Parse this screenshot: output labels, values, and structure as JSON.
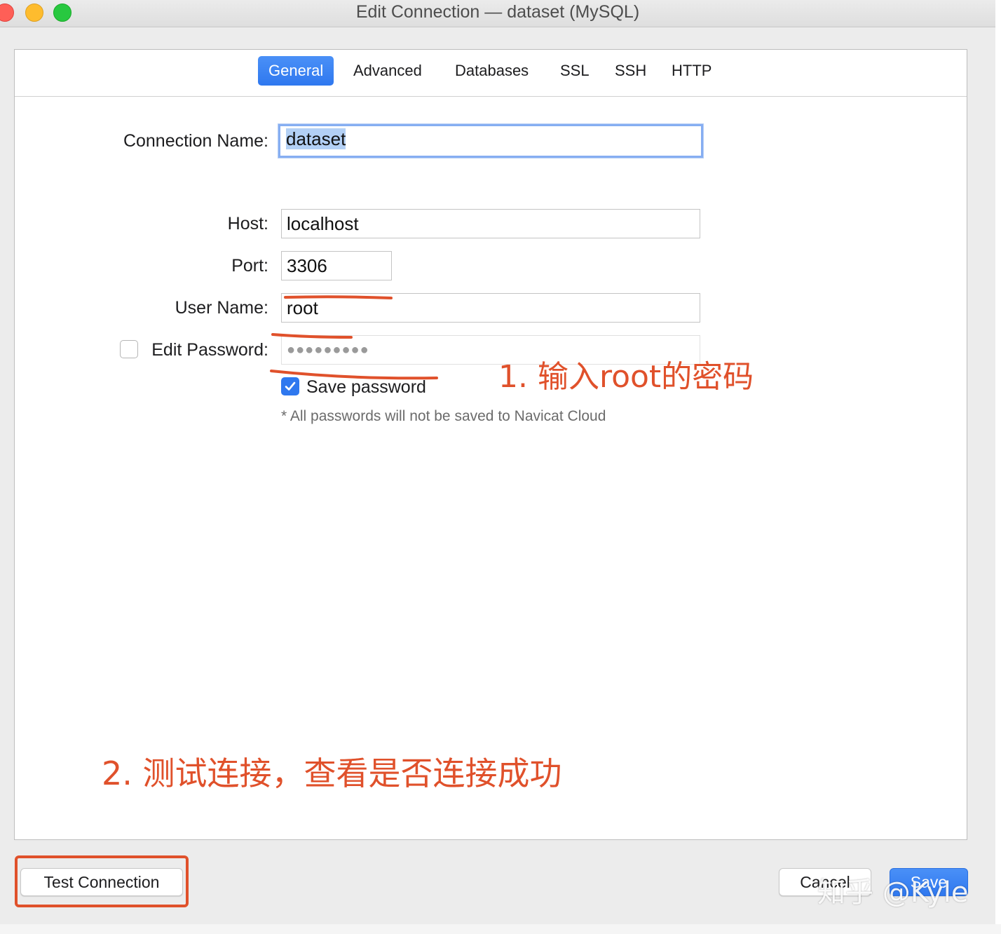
{
  "window": {
    "title": "Edit Connection — dataset (MySQL)"
  },
  "tabs": [
    {
      "label": "General",
      "active": true
    },
    {
      "label": "Advanced",
      "active": false
    },
    {
      "label": "Databases",
      "active": false
    },
    {
      "label": "SSL",
      "active": false
    },
    {
      "label": "SSH",
      "active": false
    },
    {
      "label": "HTTP",
      "active": false
    }
  ],
  "form": {
    "connection_name_label": "Connection Name:",
    "connection_name_value": "dataset",
    "host_label": "Host:",
    "host_value": "localhost",
    "port_label": "Port:",
    "port_value": "3306",
    "username_label": "User Name:",
    "username_value": "root",
    "edit_password_label": "Edit Password:",
    "edit_password_checked": false,
    "password_value": "●●●●●●●●●",
    "save_password_label": "Save password",
    "save_password_checked": true,
    "cloud_note": "* All passwords will not be saved to Navicat Cloud"
  },
  "annotations": {
    "step1": "1. 输入root的密码",
    "step2": "2. 测试连接，查看是否连接成功"
  },
  "footer": {
    "test_connection_label": "Test Connection",
    "cancel_label": "Cancel",
    "save_label": "Save"
  },
  "watermark": "知乎 @Kyle",
  "colors": {
    "accent": "#2f78ef",
    "annotation": "#e0512b"
  }
}
